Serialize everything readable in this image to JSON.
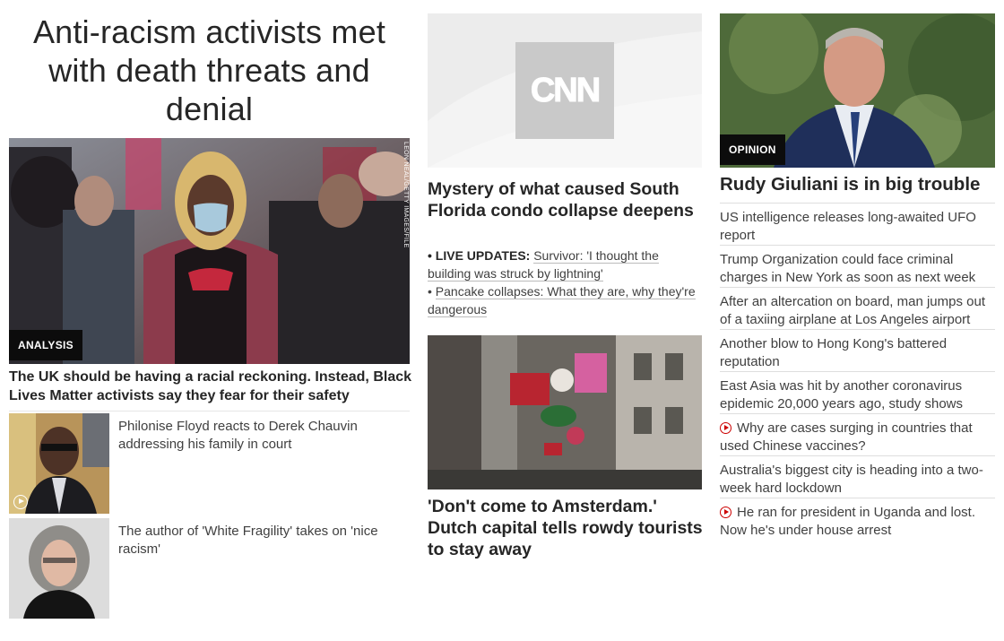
{
  "left": {
    "headline": "Anti-racism activists met with death threats and denial",
    "main_tag": "ANALYSIS",
    "photo_credit": "LEON NEAL/GETTY IMAGES/FILE",
    "main_story": "The UK should be having a racial reckoning. Instead, Black Lives Matter activists say they fear for their safety",
    "thumbs": [
      {
        "text": "Philonise Floyd reacts to Derek Chauvin addressing his family in court",
        "has_video": true
      },
      {
        "text": "The author of 'White Fragility' takes on 'nice racism'",
        "has_video": false
      }
    ]
  },
  "middle": {
    "logo": "CNN",
    "story1_title": "Mystery of what caused South Florida condo collapse deepens",
    "live_label": "LIVE UPDATES:",
    "live_text": "Survivor: 'I thought the building was struck by lightning'",
    "sub_text": "Pancake collapses: What they are, why they're dangerous",
    "story2_title": "'Don't come to Amsterdam.' Dutch capital tells rowdy tourists to stay away"
  },
  "right": {
    "tag": "OPINION",
    "title": "Rudy Giuliani is in big trouble",
    "items": [
      {
        "text": "US intelligence releases long-awaited UFO report",
        "video": false
      },
      {
        "text": "Trump Organization could face criminal charges in New York as soon as next week",
        "video": false
      },
      {
        "text": "After an altercation on board, man jumps out of a taxiing airplane at Los Angeles airport",
        "video": false
      },
      {
        "text": "Another blow to Hong Kong's battered reputation",
        "video": false
      },
      {
        "text": "East Asia was hit by another coronavirus epidemic 20,000 years ago, study shows",
        "video": false
      },
      {
        "text": "Why are cases surging in countries that used Chinese vaccines?",
        "video": true
      },
      {
        "text": "Australia's biggest city is heading into a two-week hard lockdown",
        "video": false
      },
      {
        "text": "He ran for president in Uganda and lost. Now he's under house arrest",
        "video": true
      }
    ]
  },
  "colors": {
    "tag_bg": "#0c0c0c",
    "video_red": "#cc0000",
    "text": "#262626"
  }
}
